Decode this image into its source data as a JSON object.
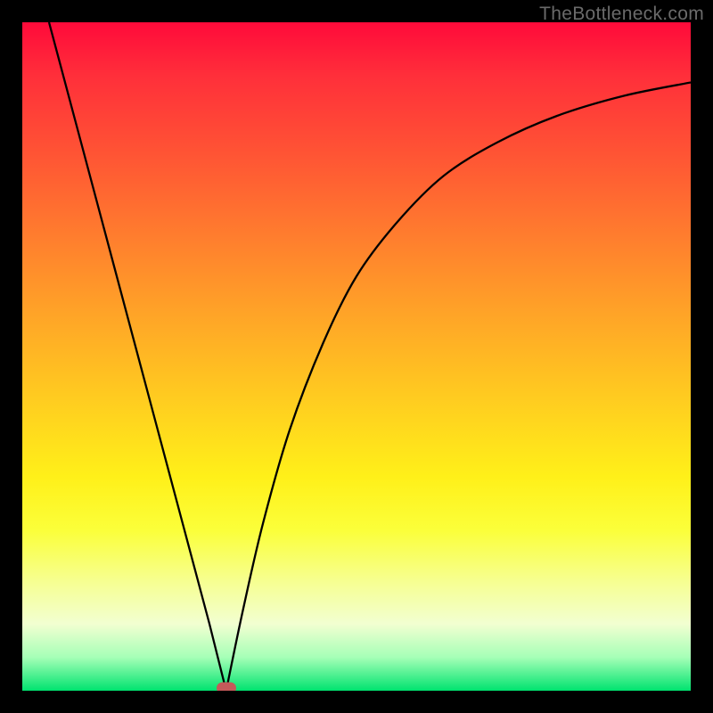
{
  "watermark": "TheBottleneck.com",
  "curve_color": "#000000",
  "curve_stroke_width": 2.3,
  "min_marker_color": "#c45a5a",
  "chart_data": {
    "type": "line",
    "title": "",
    "xlabel": "",
    "ylabel": "",
    "xlim": [
      0,
      100
    ],
    "ylim": [
      0,
      100
    ],
    "series": [
      {
        "name": "left-branch",
        "x": [
          4,
          8,
          12,
          16,
          20,
          24,
          28,
          30.5
        ],
        "y": [
          100,
          85,
          70,
          55,
          40,
          25,
          10,
          0
        ]
      },
      {
        "name": "right-branch",
        "x": [
          30.5,
          33,
          36,
          40,
          45,
          50,
          56,
          63,
          71,
          80,
          90,
          100
        ],
        "y": [
          0,
          12,
          25,
          39,
          52,
          62,
          70,
          77,
          82,
          86,
          89,
          91
        ]
      }
    ],
    "annotations": [
      {
        "name": "minimum-point",
        "x": 30.5,
        "y": 0
      }
    ],
    "grid": false,
    "legend": false
  }
}
